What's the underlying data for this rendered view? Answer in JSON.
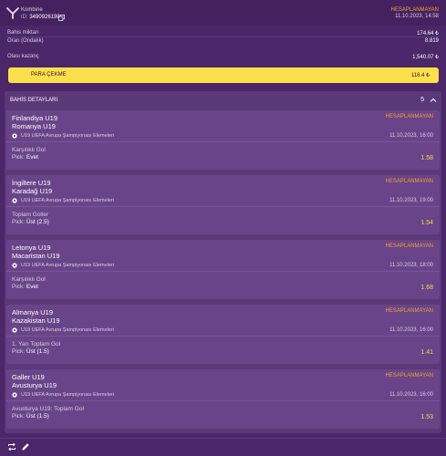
{
  "header": {
    "coupon_type": "Kombine",
    "id_prefix": "ID:",
    "coupon_id": "3490926198",
    "status": "HESAPLANMAYAN",
    "date": "11.10.2023, 14:58"
  },
  "summary": {
    "stake_label": "Bahis miktarı",
    "stake_value": "174.64 ₺",
    "odds_label": "Oran (Ondalık)",
    "odds_value": "8.819",
    "win_label": "Olası kazanç",
    "win_value": "1,540.07 ₺"
  },
  "cashout": {
    "label": "PARA ÇEKME",
    "amount": "118.4 ₺"
  },
  "details": {
    "title": "BAHİS DETAYLARI",
    "count": "5"
  },
  "bets": [
    {
      "home": "Finlandiya U19",
      "away": "Romanya U19",
      "status": "HESAPLANMAYAN",
      "league": "U19 UEFA Avrupa Şampiyonası Elemeleri",
      "date": "11.10.2023, 16:00",
      "market": "Karşılıklı Gol",
      "pick_label": "Pick:",
      "pick": "Evet",
      "odds": "1.58"
    },
    {
      "home": "İngiltere U19",
      "away": "Karadağ U19",
      "status": "HESAPLANMAYAN",
      "league": "U19 UEFA Avrupa Şampiyonası Elemeleri",
      "date": "11.10.2023, 19:00",
      "market": "Toplam Goller",
      "pick_label": "Pick:",
      "pick": "Üst (2.5)",
      "odds": "1.54"
    },
    {
      "home": "Letonya U19",
      "away": "Macaristan U19",
      "status": "HESAPLANMAYAN",
      "league": "U19 UEFA Avrupa Şampiyonası Elemeleri",
      "date": "11.10.2023, 18:00",
      "market": "Karşılıklı Gol",
      "pick_label": "Pick:",
      "pick": "Evet",
      "odds": "1.68"
    },
    {
      "home": "Almanya U19",
      "away": "Kazakistan U19",
      "status": "HESAPLANMAYAN",
      "league": "U19 UEFA Avrupa Şampiyonası Elemeleri",
      "date": "11.10.2023, 16:00",
      "market": "1. Yarı Toplam Gol",
      "pick_label": "Pick:",
      "pick": "Üst (1.5)",
      "odds": "1.41"
    },
    {
      "home": "Galler U19",
      "away": "Avusturya U19",
      "status": "HESAPLANMAYAN",
      "league": "U19 UEFA Avrupa Şampiyonası Elemeleri",
      "date": "11.10.2023, 16:00",
      "market": "Avusturya U19: Toplam Gol",
      "pick_label": "Pick:",
      "pick": "Üst (1.5)",
      "odds": "1.53"
    }
  ],
  "icons": {
    "logo": "y-logo-icon",
    "copy": "copy-icon",
    "collapse": "chevron-up-icon",
    "ball": "soccer-ball-icon",
    "repeat": "repeat-icon",
    "edit": "pencil-icon"
  },
  "colors": {
    "background": "#4b2668",
    "panel": "#5b3878",
    "card": "#6a4489",
    "status": "#f0a32c",
    "odds": "#f7d84a",
    "cashout": "#fbe04c"
  }
}
